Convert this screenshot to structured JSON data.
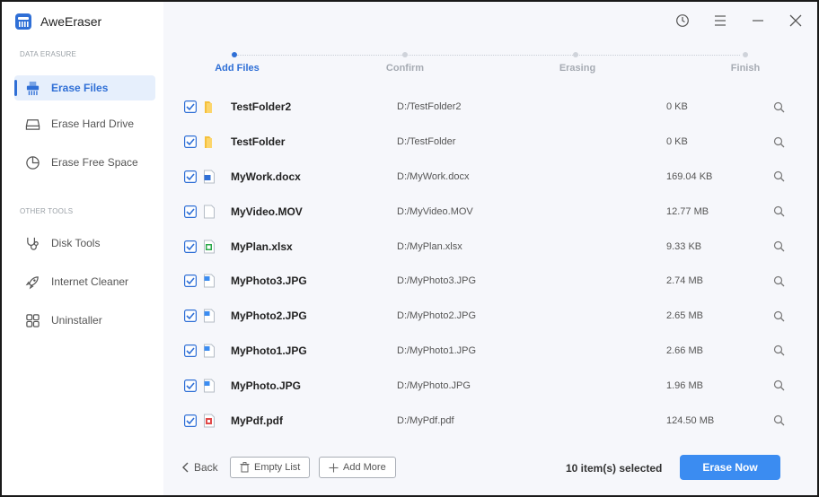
{
  "app": {
    "title": "AweEraser"
  },
  "sidebar": {
    "sections": [
      {
        "label": "DATA ERASURE"
      },
      {
        "label": "OTHER TOOLS"
      }
    ],
    "items": [
      {
        "label": "Erase Files",
        "icon": "shredder-icon",
        "active": true
      },
      {
        "label": "Erase Hard Drive",
        "icon": "hard-drive-icon"
      },
      {
        "label": "Erase Free Space",
        "icon": "pie-chart-icon"
      },
      {
        "label": "Disk Tools",
        "icon": "stethoscope-icon"
      },
      {
        "label": "Internet Cleaner",
        "icon": "rocket-icon"
      },
      {
        "label": "Uninstaller",
        "icon": "apps-grid-icon"
      }
    ]
  },
  "steps": [
    {
      "label": "Add Files",
      "active": true
    },
    {
      "label": "Confirm"
    },
    {
      "label": "Erasing"
    },
    {
      "label": "Finish"
    }
  ],
  "files": [
    {
      "name": "TestFolder2",
      "path": "D:/TestFolder2",
      "size": "0 KB",
      "type": "folder",
      "checked": true
    },
    {
      "name": "TestFolder",
      "path": "D:/TestFolder",
      "size": "0 KB",
      "type": "folder",
      "checked": true
    },
    {
      "name": "MyWork.docx",
      "path": "D:/MyWork.docx",
      "size": "169.04 KB",
      "type": "word",
      "checked": true
    },
    {
      "name": "MyVideo.MOV",
      "path": "D:/MyVideo.MOV",
      "size": "12.77 MB",
      "type": "blank",
      "checked": true
    },
    {
      "name": "MyPlan.xlsx",
      "path": "D:/MyPlan.xlsx",
      "size": "9.33 KB",
      "type": "excel",
      "checked": true
    },
    {
      "name": "MyPhoto3.JPG",
      "path": "D:/MyPhoto3.JPG",
      "size": "2.74 MB",
      "type": "image",
      "checked": true
    },
    {
      "name": "MyPhoto2.JPG",
      "path": "D:/MyPhoto2.JPG",
      "size": "2.65 MB",
      "type": "image",
      "checked": true
    },
    {
      "name": "MyPhoto1.JPG",
      "path": "D:/MyPhoto1.JPG",
      "size": "2.66 MB",
      "type": "image",
      "checked": true
    },
    {
      "name": "MyPhoto.JPG",
      "path": "D:/MyPhoto.JPG",
      "size": "1.96 MB",
      "type": "image",
      "checked": true
    },
    {
      "name": "MyPdf.pdf",
      "path": "D:/MyPdf.pdf",
      "size": "124.50 MB",
      "type": "pdf",
      "checked": true
    }
  ],
  "footer": {
    "back_label": "Back",
    "empty_list_label": "Empty List",
    "add_more_label": "Add More",
    "selected_text": "10 item(s) selected",
    "erase_label": "Erase Now"
  },
  "colors": {
    "accent": "#2f6fd6",
    "button": "#3b8cf1",
    "main_bg": "#f6f7fb"
  }
}
